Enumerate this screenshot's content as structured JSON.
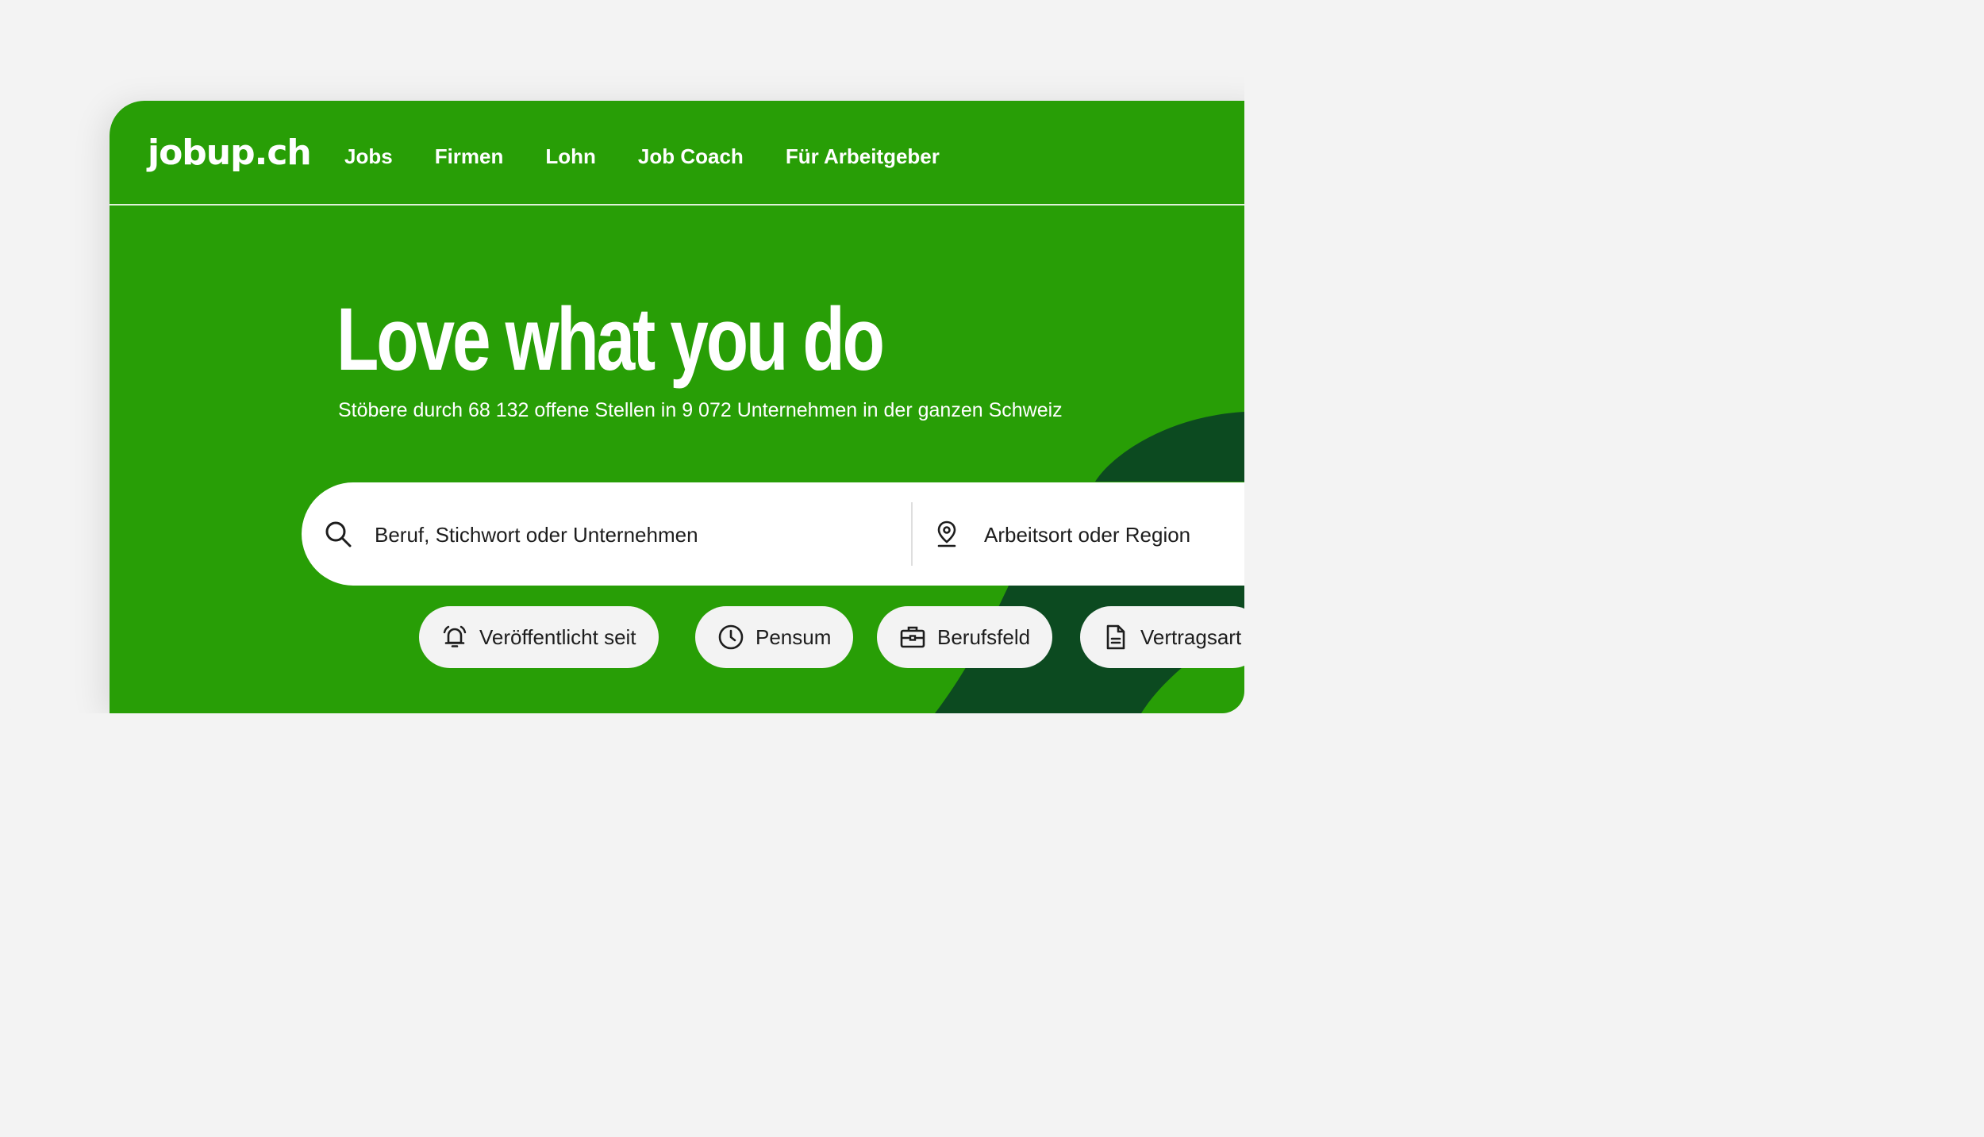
{
  "header": {
    "logo": "jobup.ch",
    "nav": [
      {
        "label": "Jobs"
      },
      {
        "label": "Firmen"
      },
      {
        "label": "Lohn"
      },
      {
        "label": "Job Coach"
      },
      {
        "label": "Für Arbeitgeber"
      }
    ]
  },
  "hero": {
    "title": "Love what you do",
    "subtitle": "Stöbere durch 68 132 offene Stellen in 9 072 Unternehmen in der ganzen Schweiz"
  },
  "search": {
    "keyword_placeholder": "Beruf, Stichwort oder Unternehmen",
    "location_placeholder": "Arbeitsort oder Region"
  },
  "filters": [
    {
      "label": "Veröffentlicht seit",
      "icon": "bell-icon"
    },
    {
      "label": "Pensum",
      "icon": "clock-icon"
    },
    {
      "label": "Berufsfeld",
      "icon": "briefcase-icon"
    },
    {
      "label": "Vertragsart",
      "icon": "document-icon"
    }
  ],
  "colors": {
    "brand_green": "#289e06",
    "dark_green": "#0c4a20",
    "chip_bg": "#f3f3f3",
    "text": "#1d1d1d"
  }
}
